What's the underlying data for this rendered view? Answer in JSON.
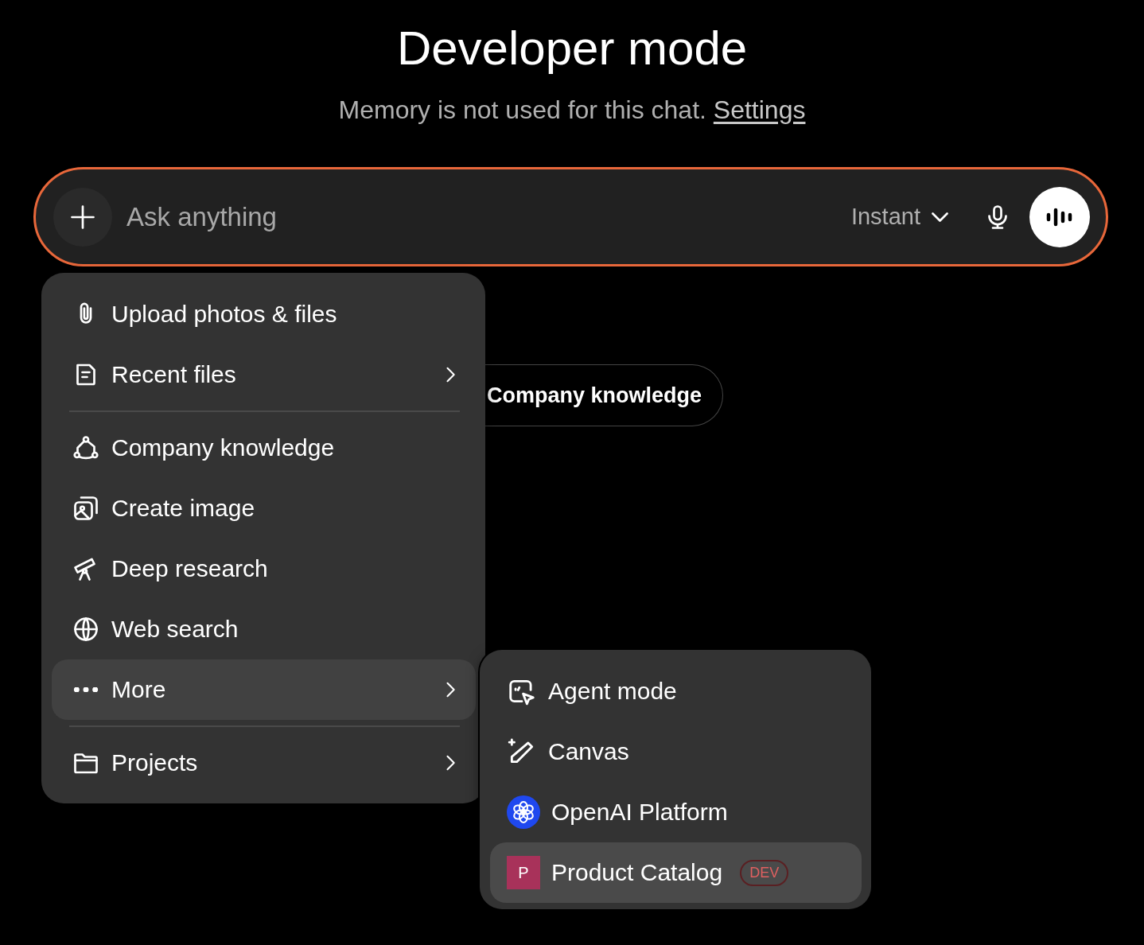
{
  "header": {
    "title": "Developer mode",
    "subtitle": "Memory is not used for this chat.",
    "settings_link": "Settings"
  },
  "composer": {
    "placeholder": "Ask anything",
    "model": "Instant"
  },
  "suggestion": {
    "label": "Company knowledge"
  },
  "menu": {
    "items": [
      {
        "kind": "item",
        "label": "Upload photos & files",
        "has_submenu": false,
        "selected": false
      },
      {
        "kind": "item",
        "label": "Recent files",
        "has_submenu": true,
        "selected": false
      },
      {
        "kind": "divider"
      },
      {
        "kind": "item",
        "label": "Company knowledge",
        "has_submenu": false,
        "selected": false
      },
      {
        "kind": "item",
        "label": "Create image",
        "has_submenu": false,
        "selected": false
      },
      {
        "kind": "item",
        "label": "Deep research",
        "has_submenu": false,
        "selected": false
      },
      {
        "kind": "item",
        "label": "Web search",
        "has_submenu": false,
        "selected": false
      },
      {
        "kind": "item",
        "label": "More",
        "has_submenu": true,
        "selected": true
      },
      {
        "kind": "divider"
      },
      {
        "kind": "item",
        "label": "Projects",
        "has_submenu": true,
        "selected": false
      }
    ]
  },
  "submenu": {
    "items": [
      {
        "kind": "icon",
        "label": "Agent mode",
        "selected": false
      },
      {
        "kind": "icon",
        "label": "Canvas",
        "selected": false
      },
      {
        "kind": "logo",
        "label": "OpenAI Platform",
        "selected": false
      },
      {
        "kind": "avatar",
        "avatar": "P",
        "color": "#a8325a",
        "label": "Product Catalog",
        "badge": "DEV",
        "selected": true
      }
    ]
  }
}
